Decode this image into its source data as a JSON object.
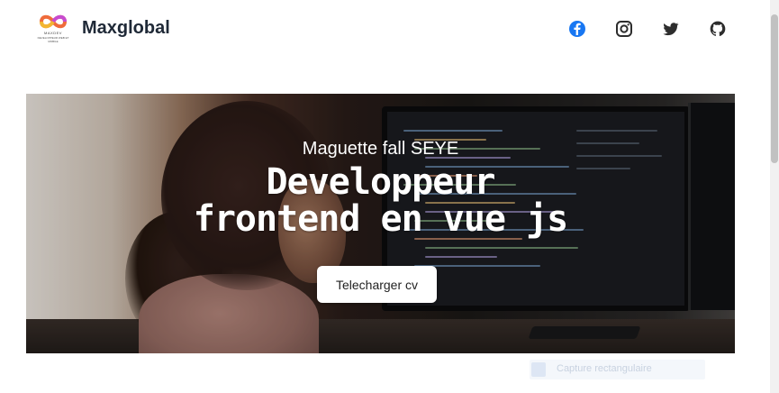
{
  "header": {
    "logo": {
      "line1": "MAXDEV",
      "line2": "DEVELOPPEUR WEB ET MOBILE"
    },
    "brand": "Maxglobal",
    "social": [
      {
        "name": "facebook-icon",
        "color": "#1877f2"
      },
      {
        "name": "instagram-icon",
        "color": "#2d2d2d"
      },
      {
        "name": "twitter-icon",
        "color": "#2d2d2d"
      },
      {
        "name": "github-icon",
        "color": "#2d2d2d"
      }
    ]
  },
  "hero": {
    "subtitle": "Maguette fall SEYE",
    "title_line1": "Developpeur",
    "title_line2": "frontend en vue js",
    "button_label": "Telecharger cv"
  },
  "overlay": {
    "capture_label": "Capture rectangulaire"
  }
}
